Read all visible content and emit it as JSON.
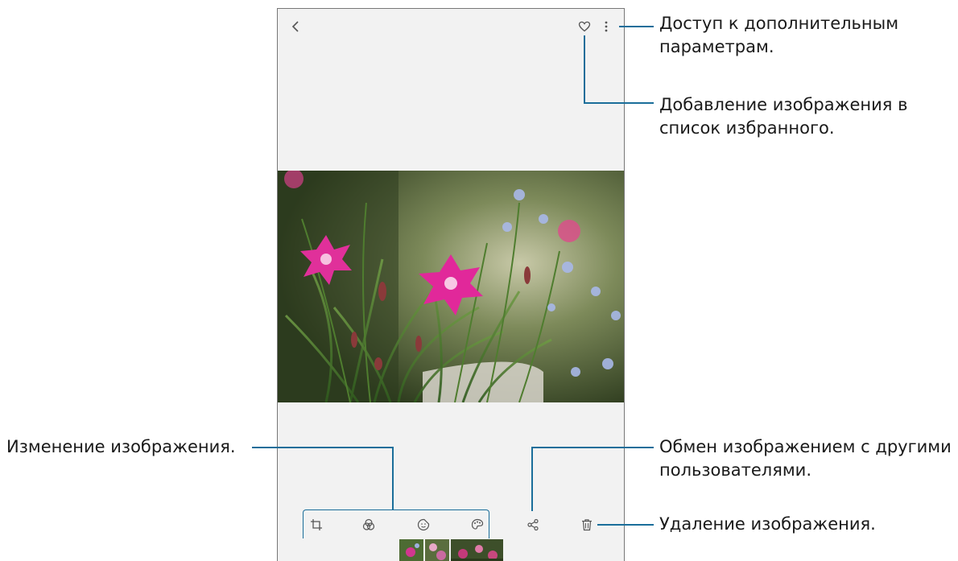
{
  "callouts": {
    "more_options": "Доступ к дополнительным параметрам.",
    "favorite": "Добавление изображения в список избранного.",
    "edit": "Изменение изображения.",
    "share": "Обмен изображением с другими пользователями.",
    "delete": "Удаление изображения."
  },
  "toolbar_top": {
    "icons": [
      "back-icon",
      "heart-icon",
      "more-vertical-icon"
    ]
  },
  "toolbar_bottom": {
    "icons": [
      "crop-icon",
      "filter-icon",
      "sticker-icon",
      "palette-icon",
      "share-icon",
      "trash-icon"
    ]
  },
  "colors": {
    "callout_line": "#1a6e9a",
    "screen_bg": "#f2f2f2",
    "icon": "#555555"
  }
}
